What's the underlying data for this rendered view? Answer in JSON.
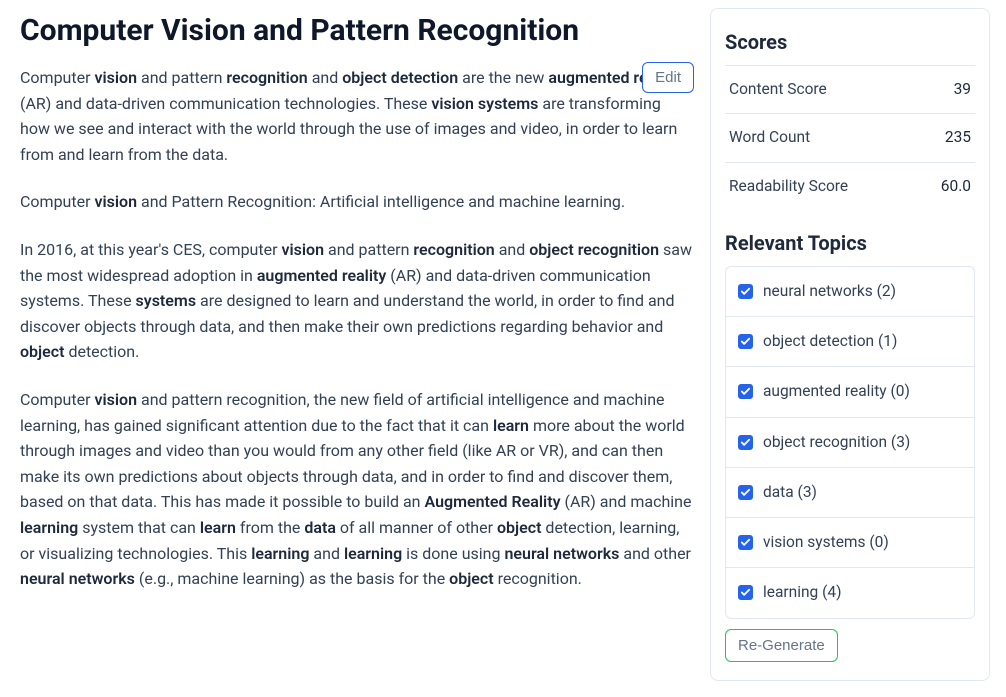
{
  "article": {
    "title": "Computer Vision and Pattern Recognition",
    "edit_label": "Edit",
    "paragraphs_html": [
      "Computer <strong>vision</strong> and pattern <strong>recognition</strong> and <strong>object detection</strong> are the new <strong>augmented reality</strong> (AR) and data-driven communication technologies. These <strong>vision systems</strong> are transforming how we see and interact with the world through the use of images and video, in order to learn from and learn from the data.",
      "Computer <strong>vision</strong> and Pattern Recognition: Artificial intelligence and machine learning.",
      "In 2016, at this year's CES, computer <strong>vision</strong> and pattern <strong>recognition</strong> and <strong>object recognition</strong> saw the most widespread adoption in <strong>augmented reality</strong> (AR) and data-driven communication systems. These <strong>systems</strong> are designed to learn and understand the world, in order to find and discover objects through data, and then make their own predictions regarding behavior and <strong>object</strong> detection.",
      "Computer <strong>vision</strong> and pattern recognition, the new field of artificial intelligence and machine learning, has gained significant attention due to the fact that it can <strong>learn</strong> more about the world through images and video than you would from any other field (like AR or VR), and can then make its own predictions about objects through data, and in order to find and discover them, based on that data. This has made it possible to build an <strong>Augmented Reality</strong> (AR) and machine <strong>learning</strong> system that can <strong>learn</strong> from the <strong>data</strong> of all manner of other <strong>object</strong> detection, learning, or visualizing technologies. This <strong>learning</strong> and <strong>learning</strong> is done using <strong>neural networks</strong> and other <strong>neural networks</strong> (e.g., machine learning) as the basis for the <strong>object</strong> recognition."
    ]
  },
  "sidebar": {
    "scores_heading": "Scores",
    "scores": [
      {
        "label": "Content Score",
        "value": "39"
      },
      {
        "label": "Word Count",
        "value": "235"
      },
      {
        "label": "Readability Score",
        "value": "60.0"
      }
    ],
    "topics_heading": "Relevant Topics",
    "topics": [
      {
        "label": "neural networks",
        "count": 2,
        "checked": true
      },
      {
        "label": "object detection",
        "count": 1,
        "checked": true
      },
      {
        "label": "augmented reality",
        "count": 0,
        "checked": true
      },
      {
        "label": "object recognition",
        "count": 3,
        "checked": true
      },
      {
        "label": "data",
        "count": 3,
        "checked": true
      },
      {
        "label": "vision systems",
        "count": 0,
        "checked": true
      },
      {
        "label": "learning",
        "count": 4,
        "checked": true
      }
    ],
    "regenerate_label": "Re-Generate"
  }
}
